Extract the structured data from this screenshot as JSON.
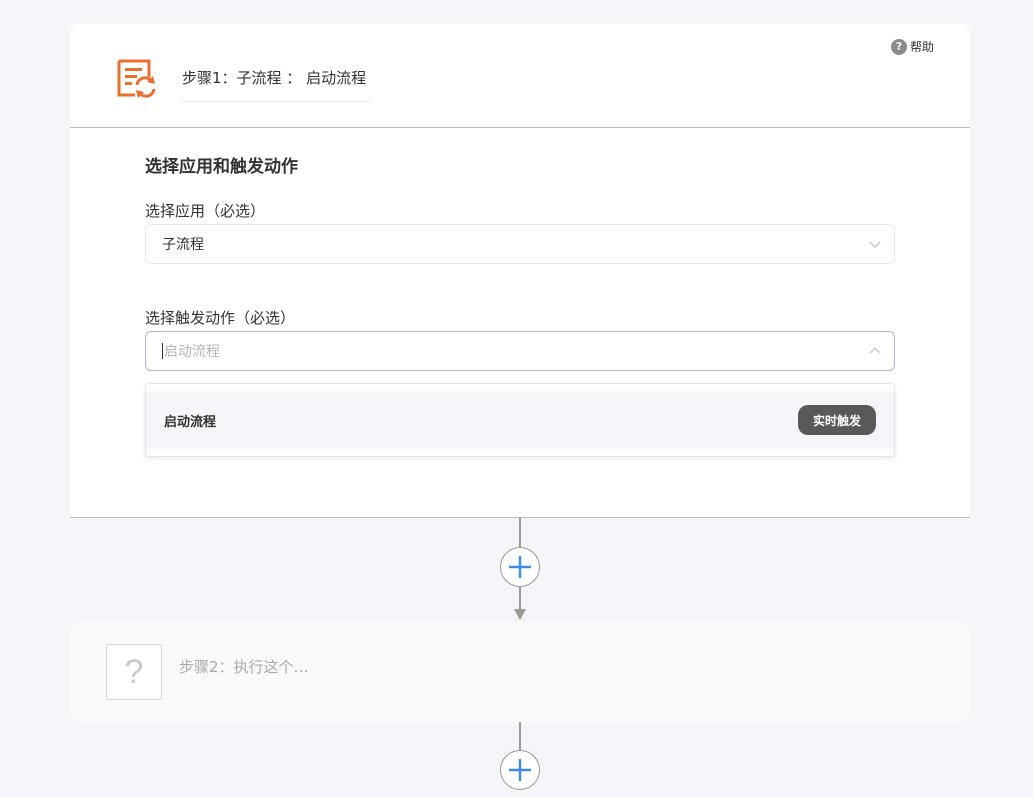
{
  "step1": {
    "title": "步骤1：子流程 ： 启动流程",
    "help_label": "帮助",
    "help_icon": "question-circle-icon",
    "app_icon": "subflow-refresh-icon",
    "section_title": "选择应用和触发动作",
    "app_field": {
      "label": "选择应用（必选）",
      "value": "子流程"
    },
    "trigger_field": {
      "label": "选择触发动作（必选）",
      "placeholder": "启动流程"
    },
    "dropdown": {
      "options": [
        {
          "label": "启动流程",
          "badge": "实时触发"
        }
      ]
    }
  },
  "step2": {
    "title": "步骤2：执行这个…",
    "icon": "?"
  },
  "colors": {
    "accent_orange": "#ea6f2d",
    "plus_blue": "#3a8ee6",
    "badge_bg": "#595959"
  }
}
